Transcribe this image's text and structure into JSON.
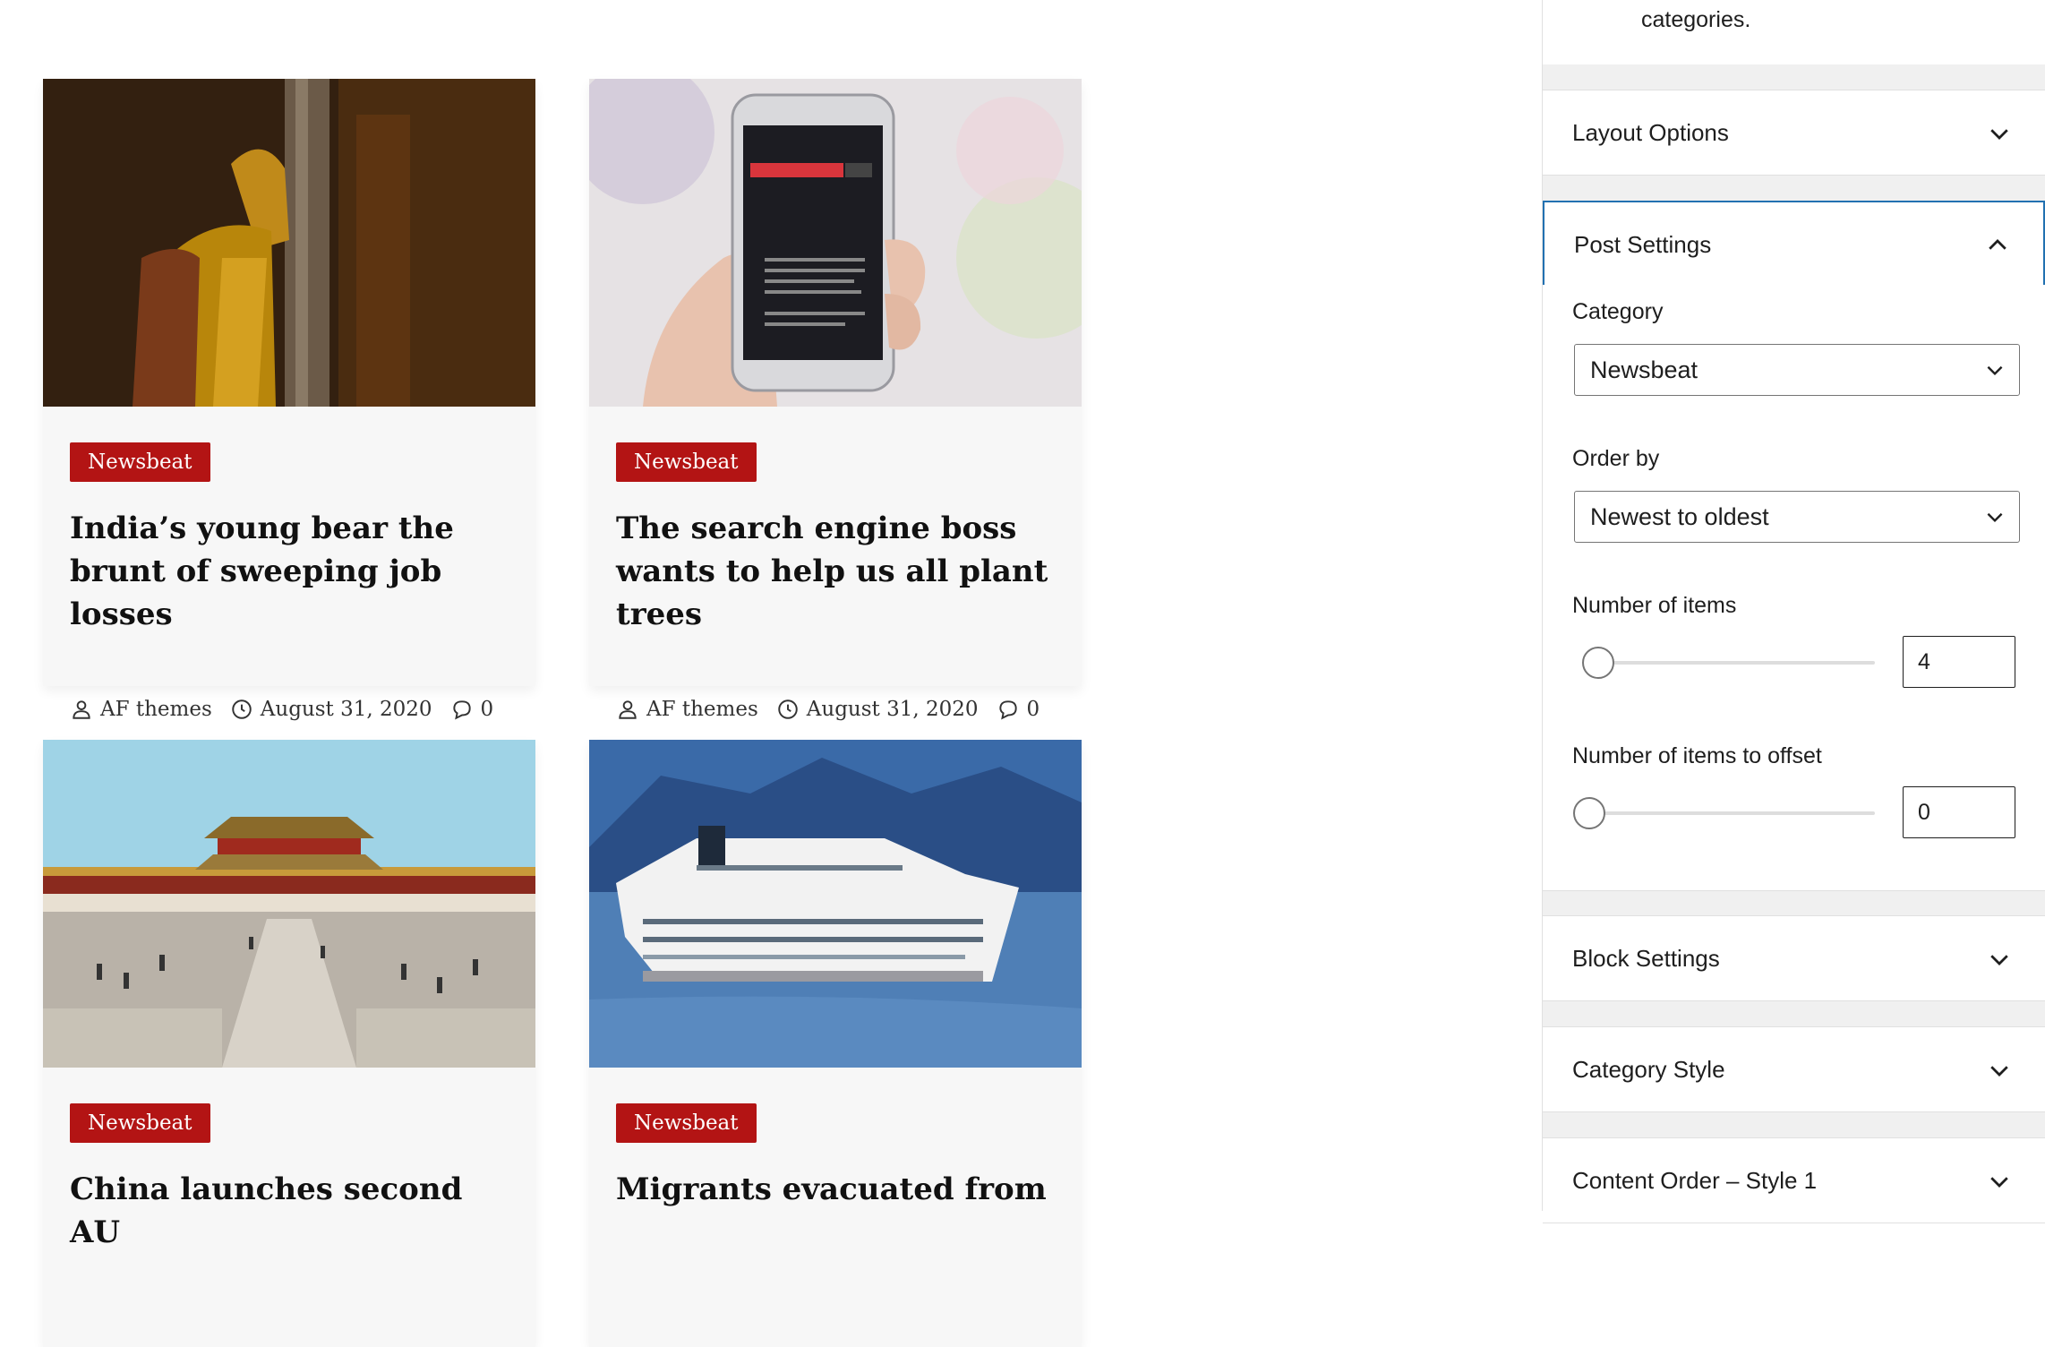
{
  "sidebar": {
    "intro_tail": "categories.",
    "panels": [
      {
        "label": "Layout Options",
        "state": "collapsed"
      },
      {
        "label": "Post Settings",
        "state": "expanded"
      },
      {
        "label": "Block Settings",
        "state": "collapsed"
      },
      {
        "label": "Category Style",
        "state": "collapsed"
      },
      {
        "label": "Content Order – Style 1",
        "state": "collapsed"
      }
    ],
    "post_settings": {
      "category_label": "Category",
      "category_value": "Newsbeat",
      "orderby_label": "Order by",
      "orderby_value": "Newest to oldest",
      "items_label": "Number of items",
      "items_value": "4",
      "offset_label": "Number of items to offset",
      "offset_value": "0"
    }
  },
  "posts": [
    {
      "category": "Newsbeat",
      "title": "India’s young bear the brunt of sweeping job losses",
      "author": "AF themes",
      "date": "August 31, 2020",
      "comments": "0",
      "image": "woman-in-yellow-sari"
    },
    {
      "category": "Newsbeat",
      "title": "The search engine boss wants to help us all plant trees",
      "author": "AF themes",
      "date": "August 31, 2020",
      "comments": "0",
      "image": "hand-holding-phone"
    },
    {
      "category": "Newsbeat",
      "title": "China launches second AU",
      "image": "forbidden-city"
    },
    {
      "category": "Newsbeat",
      "title": "Migrants evacuated from",
      "image": "cruise-ship"
    }
  ],
  "colors": {
    "badge": "#b31414",
    "focus": "#2271b1"
  }
}
